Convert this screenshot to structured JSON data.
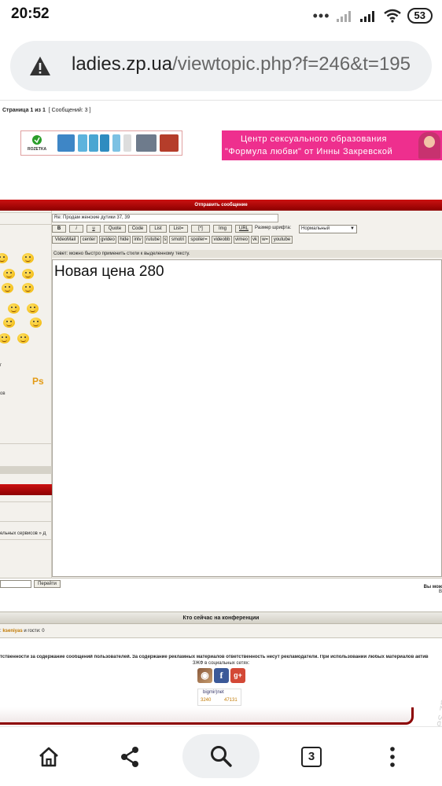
{
  "status": {
    "time": "20:52",
    "dots": "•••",
    "battery": "53"
  },
  "browser": {
    "domain": "ladies.zp.ua",
    "path": "/viewtopic.php?f=246&t=195",
    "tabs_count": "3"
  },
  "page": {
    "pager_label": "Страница 1 из 1",
    "posts_count": "[ Сообщений: 3 ]",
    "banner_left_brand": "ROZETKA",
    "banner_right_line1": "Центр сексуального образования",
    "banner_right_line2": "\"Формула любви\" от Инны Закревской",
    "post_header": "Отправить сообщение",
    "subject": "Re: Продам женские дутики 37, 39",
    "toolbar_row1": [
      "B",
      "i",
      "u",
      "Quote",
      "Code",
      "List",
      "List=",
      "[*]",
      "Img",
      "URL"
    ],
    "toolbar_row2": [
      "VideoMail",
      "center",
      "gvideo",
      "hide",
      "intv",
      "rutube",
      "s",
      "smotri",
      "spoiler=",
      "videobb",
      "vimeo",
      "vk",
      "w=",
      "youtube"
    ],
    "font_size_label": "Размер шрифта:",
    "font_size_value": "Нормальный",
    "tip": "Совет: можно быстро применить стили к выделенному тексту.",
    "message": "Новая цена 280",
    "side_letter": "г",
    "side_letter2": "ов",
    "ps_badge": "Рs",
    "breadcrumb": "ельных сервисов » Д",
    "jump_button": "Перейти",
    "right_note_1": "Вы мож",
    "right_note_2": "В",
    "who_online": "Кто сейчас на конференции",
    "who_prefix": ": ",
    "who_user": "kseniyas",
    "who_suffix": " и гости: 0",
    "disclaimer": "тственности за содержание сообщений пользователей. За содержание рекламных материалов ответственность несут рекламодатели. При использовании любых материалов актив",
    "social_label": "ЗЖФ в социальных сетях:",
    "counter_label": "bigmir)net",
    "counter_a": "3240",
    "counter_b": "47131",
    "watermark": "Ladies.zp.ua"
  },
  "colors": {
    "accent_red": "#8c0000",
    "banner_pink": "#ee2f8e",
    "page_bg": "#f3f1ec"
  }
}
